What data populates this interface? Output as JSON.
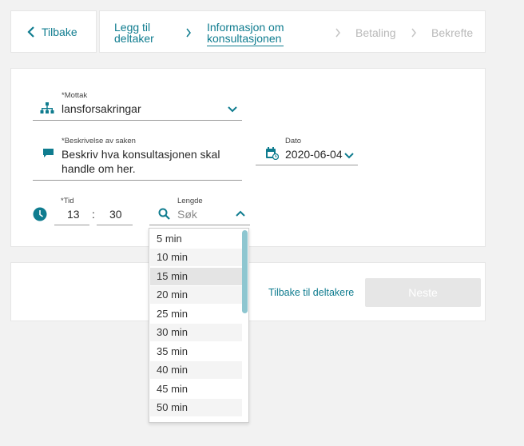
{
  "stepper": {
    "back_label": "Tilbake",
    "steps": [
      {
        "line1": "Legg til",
        "line2": "deltaker",
        "state": "done"
      },
      {
        "line1": "Informasjon om",
        "line2": "konsultasjonen",
        "state": "active"
      },
      {
        "line1": "Betaling",
        "state": "future"
      },
      {
        "line1": "Bekrefte",
        "state": "future"
      }
    ]
  },
  "form": {
    "mottak": {
      "label": "*Mottak",
      "value": "lansforsakringar",
      "icon": "org-chart-icon"
    },
    "beskrivelse": {
      "label": "*Beskrivelse av saken",
      "placeholder_line1": "Beskriv hva konsultasjonen skal",
      "placeholder_line2": "handle om her.",
      "icon": "chat-icon"
    },
    "dato": {
      "label": "Dato",
      "value": "2020-06-04",
      "icon": "calendar-icon"
    },
    "tid": {
      "label": "*Tid",
      "hours": "13",
      "separator": ":",
      "minutes": "30",
      "icon": "clock-icon"
    },
    "lengde": {
      "label": "Lengde",
      "placeholder": "Søk",
      "icon": "search-icon"
    }
  },
  "footer": {
    "back_link": "Tilbake til deltakere",
    "next_label": "Neste"
  },
  "dropdown": {
    "options": [
      "5 min",
      "10 min",
      "15 min",
      "20 min",
      "25 min",
      "30 min",
      "35 min",
      "40 min",
      "45 min",
      "50 min"
    ],
    "highlighted": "15 min"
  },
  "colors": {
    "accent": "#0f7c8f",
    "disabled": "#e6e6e6",
    "muted_text": "#b9b9b9"
  }
}
